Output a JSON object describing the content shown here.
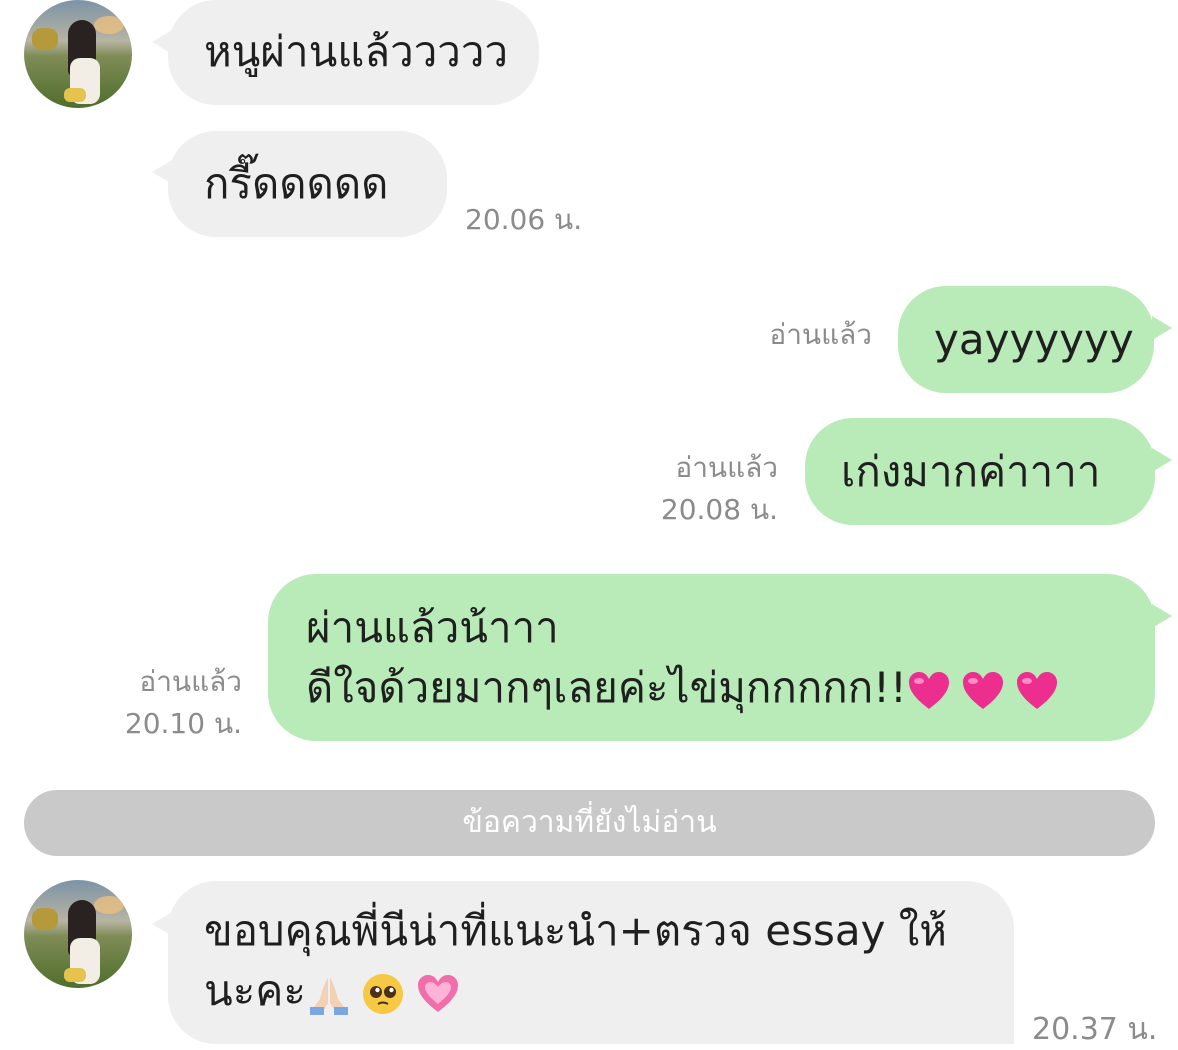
{
  "messages": {
    "m1": "หนูผ่านแล้ววววว",
    "m2": "กรี๊ดดดดด",
    "m2_time": "20.06 น.",
    "m3": "yayyyyyy",
    "m3_read": "อ่านแล้ว",
    "m4": "เก่งมากค่าาาา",
    "m4_read": "อ่านแล้ว",
    "m4_time": "20.08 น.",
    "m5_line1": "ผ่านแล้วน้าาา",
    "m5_line2": "ดีใจด้วยมากๆเลยค่ะไข่มุกกกกก!!",
    "m5_read": "อ่านแล้ว",
    "m5_time": "20.10 น.",
    "unread_divider": "ข้อความที่ยังไม่อ่าน",
    "m6_line1": "ขอบคุณพี่นีน่าที่แนะนำ+ตรวจ essay ให้",
    "m6_line2": "นะคะ",
    "m6_time": "20.37 น."
  },
  "emoji_icons": {
    "m5": [
      "heart-icon",
      "heart-icon",
      "heart-icon"
    ],
    "m6": [
      "folded-hands-icon",
      "pleading-face-icon",
      "heart-icon"
    ]
  },
  "colors": {
    "incoming_bubble": "#efefef",
    "outgoing_bubble": "#b9ebb8",
    "meta_text": "#8b8b8b",
    "divider": "#c9c9c9"
  }
}
